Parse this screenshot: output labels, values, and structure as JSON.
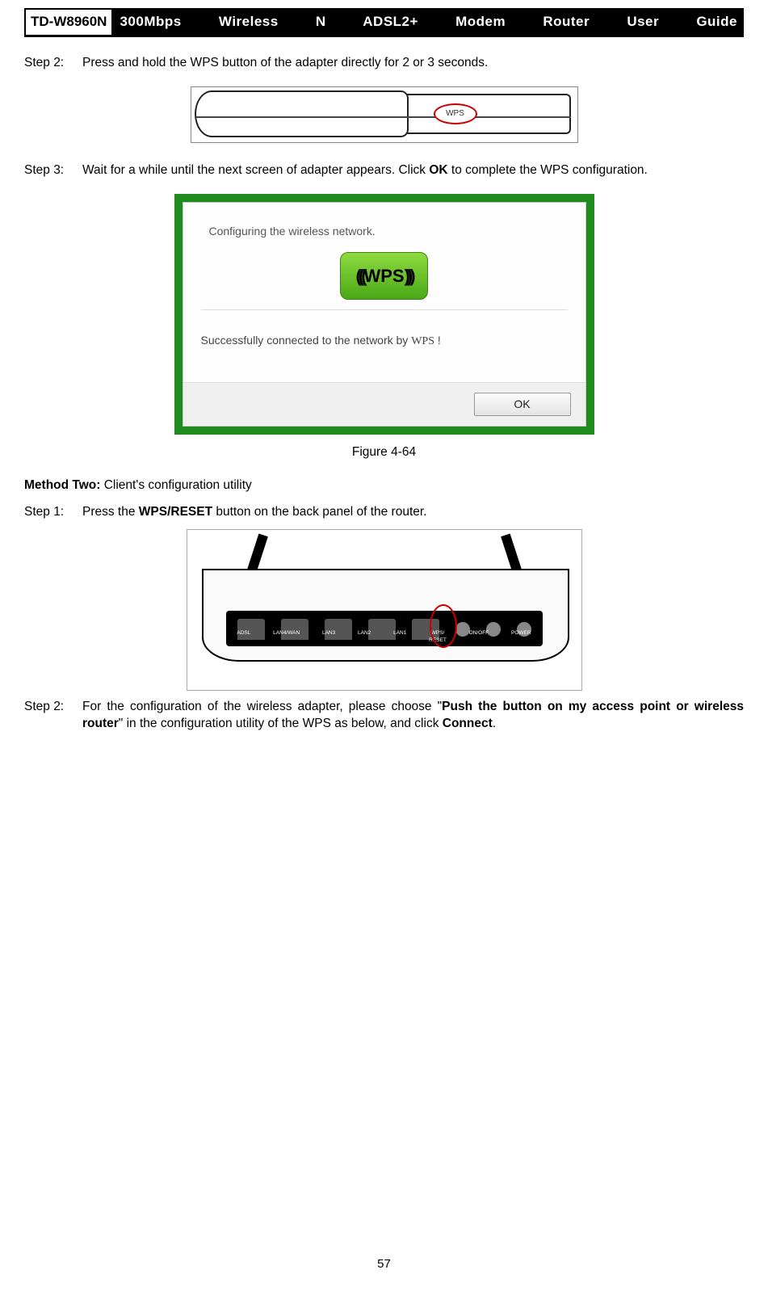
{
  "header": {
    "model": "TD-W8960N",
    "title": "300Mbps Wireless N ADSL2+ Modem Router User Guide"
  },
  "step2_label": "Step 2:",
  "step2_text": "Press and hold the WPS button of the adapter directly for 2 or 3 seconds.",
  "adapter_wps_label": "WPS",
  "step3_label": "Step 3:",
  "step3_text_a": "Wait for a while until the next screen of adapter appears. Click ",
  "step3_bold": "OK",
  "step3_text_b": " to complete the WPS configuration.",
  "dialog": {
    "configuring": "Configuring the wireless network.",
    "badge_waves_l": "(((",
    "badge_text": "WPS",
    "badge_waves_r": ")))",
    "success_a": "Successfully connected to the network by ",
    "success_wps": "WPS",
    "success_b": " !",
    "ok": "OK"
  },
  "figure_label": "Figure 4-64",
  "method2_a": "Method Two:",
  "method2_b": " Client's configuration utility",
  "m2_step1_label": "Step 1:",
  "m2_step1_a": "Press the ",
  "m2_step1_bold": "WPS/RESET",
  "m2_step1_b": " button on the back panel of the router.",
  "router_ports": {
    "p1": "ADSL",
    "p2": "LAN4/WAN",
    "p3": "LAN3",
    "p4": "LAN2",
    "p5": "LAN1",
    "p6": "WPS/\nRESET",
    "p7": "ON/OFF",
    "p8": "POWER"
  },
  "m2_step2_label": "Step 2:",
  "m2_step2_a": "For the configuration of the wireless adapter, please choose \"",
  "m2_step2_bold1": "Push the button on my access point or wireless router",
  "m2_step2_b": "\" in the configuration utility of the WPS as below, and click ",
  "m2_step2_bold2": "Connect",
  "m2_step2_c": ".",
  "page_number": "57"
}
